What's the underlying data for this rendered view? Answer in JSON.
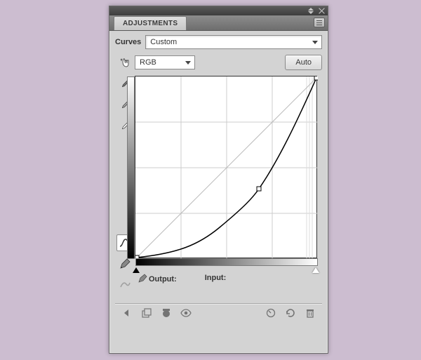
{
  "tab": {
    "title": "ADJUSTMENTS"
  },
  "section": {
    "label": "Curves"
  },
  "preset": {
    "value": "Custom"
  },
  "channel": {
    "value": "RGB"
  },
  "buttons": {
    "auto": "Auto"
  },
  "readout": {
    "output": "Output:",
    "input": "Input:"
  }
}
